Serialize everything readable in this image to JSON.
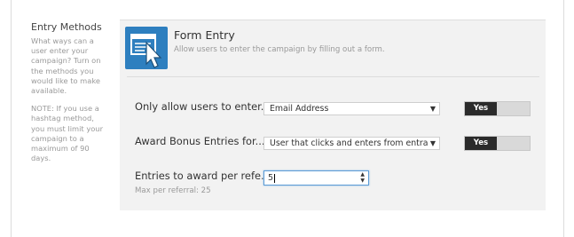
{
  "sidebar": {
    "title": "Entry Methods",
    "help_text": "What ways can a user enter your campaign? Turn on the methods you would like to make available.",
    "note_text": "NOTE: If you use a hashtag method, you must limit your campaign to a maximum of 90 days."
  },
  "method": {
    "icon": "form-icon",
    "title": "Form Entry",
    "description": "Allow users to enter the campaign by filling out a form."
  },
  "settings": {
    "only_allow": {
      "label": "Only allow users to enter...",
      "selected": "Email Address",
      "toggle_label": "Yes"
    },
    "award_bonus": {
      "label": "Award Bonus Entries for...",
      "selected": "User that clicks and enters from entra",
      "toggle_label": "Yes"
    },
    "entries_to_award": {
      "label": "Entries to award per refe...",
      "value": "5",
      "hint": "Max per referral: 25"
    }
  },
  "colors": {
    "icon_bg": "#2e7fbf",
    "toggle_on": "#2b2b2b",
    "panel_bg": "#f2f2f2",
    "focus_border": "#5b9bd5"
  }
}
